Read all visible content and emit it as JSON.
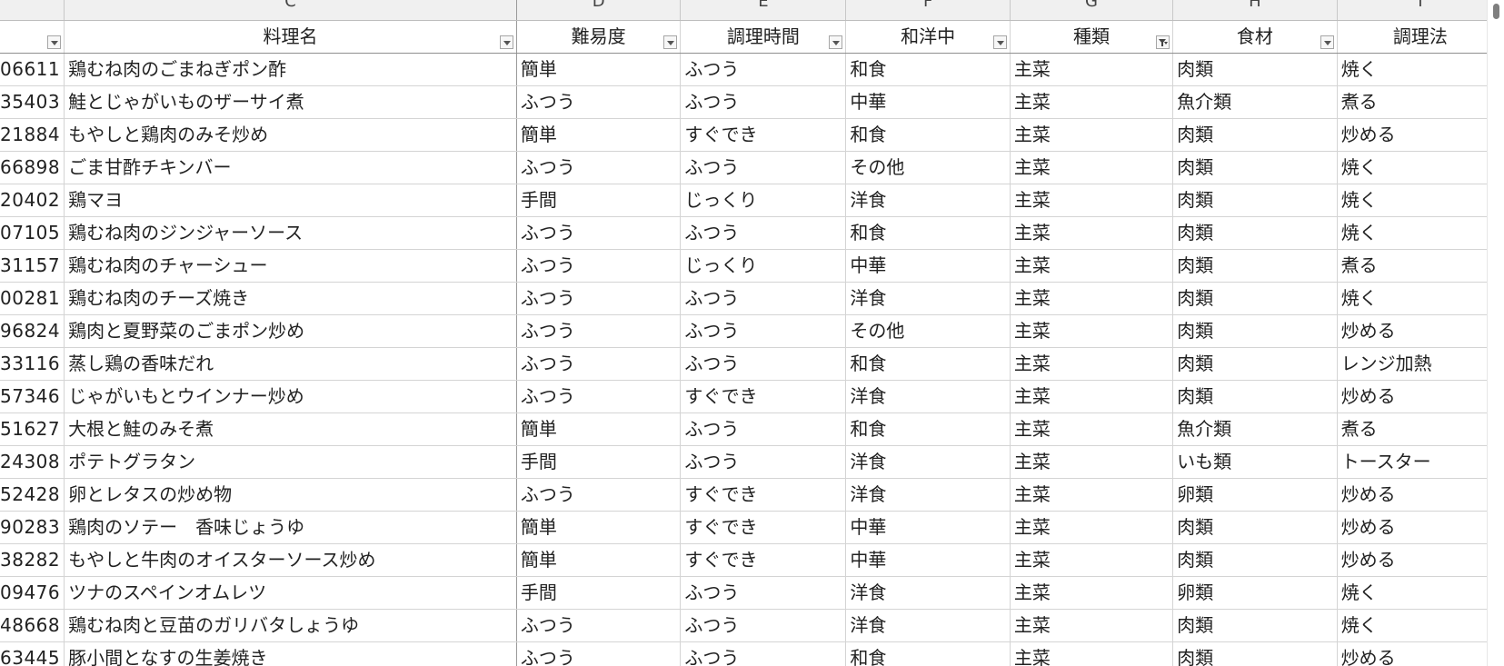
{
  "columns": {
    "letters": [
      "",
      "C",
      "D",
      "E",
      "F",
      "G",
      "H",
      "I"
    ],
    "headers": [
      "",
      "料理名",
      "難易度",
      "調理時間",
      "和洋中",
      "種類",
      "食材",
      "調理法"
    ],
    "active_filter_column": "G"
  },
  "rows": [
    {
      "id": "06611",
      "name": "鶏むね肉のごまねぎポン酢",
      "difficulty": "簡単",
      "time": "ふつう",
      "cuisine": "和食",
      "type": "主菜",
      "ingredient": "肉類",
      "method": "焼く"
    },
    {
      "id": "35403",
      "name": "鮭とじゃがいものザーサイ煮",
      "difficulty": "ふつう",
      "time": "ふつう",
      "cuisine": "中華",
      "type": "主菜",
      "ingredient": "魚介類",
      "method": "煮る"
    },
    {
      "id": "21884",
      "name": "もやしと鶏肉のみそ炒め",
      "difficulty": "簡単",
      "time": "すぐでき",
      "cuisine": "和食",
      "type": "主菜",
      "ingredient": "肉類",
      "method": "炒める"
    },
    {
      "id": "66898",
      "name": "ごま甘酢チキンバー",
      "difficulty": "ふつう",
      "time": "ふつう",
      "cuisine": "その他",
      "type": "主菜",
      "ingredient": "肉類",
      "method": "焼く"
    },
    {
      "id": "20402",
      "name": "鶏マヨ",
      "difficulty": "手間",
      "time": "じっくり",
      "cuisine": "洋食",
      "type": "主菜",
      "ingredient": "肉類",
      "method": "焼く"
    },
    {
      "id": "07105",
      "name": "鶏むね肉のジンジャーソース",
      "difficulty": "ふつう",
      "time": "ふつう",
      "cuisine": "和食",
      "type": "主菜",
      "ingredient": "肉類",
      "method": "焼く"
    },
    {
      "id": "31157",
      "name": "鶏むね肉のチャーシュー",
      "difficulty": "ふつう",
      "time": "じっくり",
      "cuisine": "中華",
      "type": "主菜",
      "ingredient": "肉類",
      "method": "煮る"
    },
    {
      "id": "00281",
      "name": "鶏むね肉のチーズ焼き",
      "difficulty": "ふつう",
      "time": "ふつう",
      "cuisine": "洋食",
      "type": "主菜",
      "ingredient": "肉類",
      "method": "焼く"
    },
    {
      "id": "96824",
      "name": "鶏肉と夏野菜のごまポン炒め",
      "difficulty": "ふつう",
      "time": "ふつう",
      "cuisine": "その他",
      "type": "主菜",
      "ingredient": "肉類",
      "method": "炒める"
    },
    {
      "id": "33116",
      "name": "蒸し鶏の香味だれ",
      "difficulty": "ふつう",
      "time": "ふつう",
      "cuisine": "和食",
      "type": "主菜",
      "ingredient": "肉類",
      "method": "レンジ加熱"
    },
    {
      "id": "57346",
      "name": "じゃがいもとウインナー炒め",
      "difficulty": "ふつう",
      "time": "すぐでき",
      "cuisine": "洋食",
      "type": "主菜",
      "ingredient": "肉類",
      "method": "炒める"
    },
    {
      "id": "51627",
      "name": "大根と鮭のみそ煮",
      "difficulty": "簡単",
      "time": "ふつう",
      "cuisine": "和食",
      "type": "主菜",
      "ingredient": "魚介類",
      "method": "煮る"
    },
    {
      "id": "24308",
      "name": "ポテトグラタン",
      "difficulty": "手間",
      "time": "ふつう",
      "cuisine": "洋食",
      "type": "主菜",
      "ingredient": "いも類",
      "method": "トースター"
    },
    {
      "id": "52428",
      "name": "卵とレタスの炒め物",
      "difficulty": "ふつう",
      "time": "すぐでき",
      "cuisine": "洋食",
      "type": "主菜",
      "ingredient": "卵類",
      "method": "炒める"
    },
    {
      "id": "90283",
      "name": "鶏肉のソテー　香味じょうゆ",
      "difficulty": "簡単",
      "time": "すぐでき",
      "cuisine": "中華",
      "type": "主菜",
      "ingredient": "肉類",
      "method": "炒める"
    },
    {
      "id": "38282",
      "name": "もやしと牛肉のオイスターソース炒め",
      "difficulty": "簡単",
      "time": "すぐでき",
      "cuisine": "中華",
      "type": "主菜",
      "ingredient": "肉類",
      "method": "炒める"
    },
    {
      "id": "09476",
      "name": "ツナのスペインオムレツ",
      "difficulty": "手間",
      "time": "ふつう",
      "cuisine": "洋食",
      "type": "主菜",
      "ingredient": "卵類",
      "method": "焼く"
    },
    {
      "id": "48668",
      "name": "鶏むね肉と豆苗のガリバタしょうゆ",
      "difficulty": "ふつう",
      "time": "ふつう",
      "cuisine": "洋食",
      "type": "主菜",
      "ingredient": "肉類",
      "method": "焼く"
    },
    {
      "id": "63445",
      "name": "豚小間となすの生姜焼き",
      "difficulty": "ふつう",
      "time": "ふつう",
      "cuisine": "和食",
      "type": "主菜",
      "ingredient": "肉類",
      "method": "炒める"
    }
  ]
}
